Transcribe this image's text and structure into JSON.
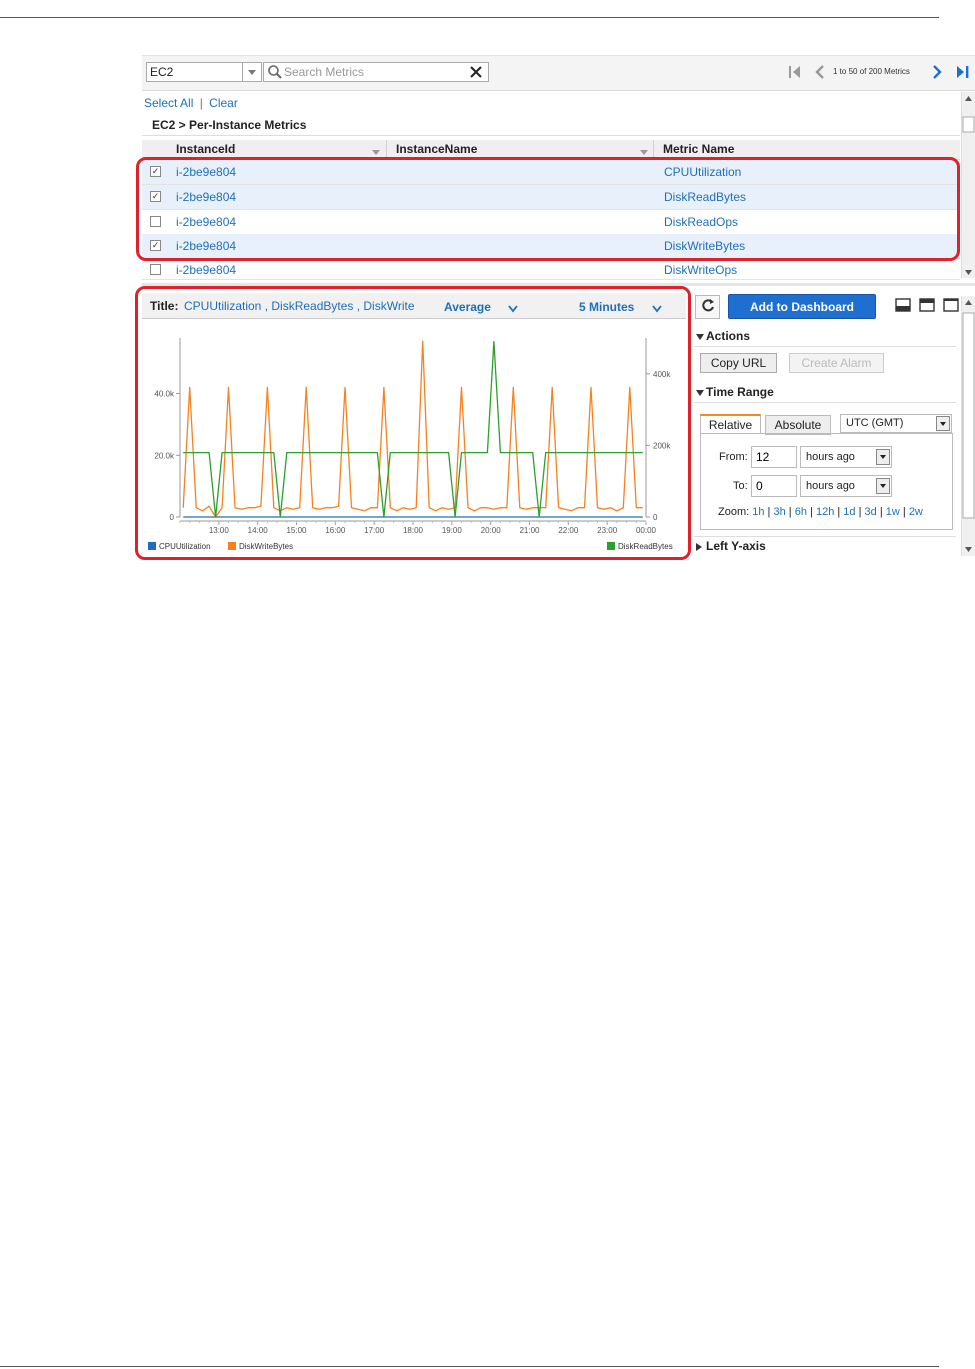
{
  "toolbar": {
    "namespace": "EC2",
    "search_placeholder": "Search Metrics",
    "pager_text": "1 to 50 of 200 Metrics"
  },
  "selection": {
    "select_all": "Select All",
    "separator": "|",
    "clear": "Clear"
  },
  "group_title": "EC2 > Per-Instance Metrics",
  "table": {
    "columns": [
      "InstanceId",
      "InstanceName",
      "Metric Name"
    ],
    "rows": [
      {
        "checked": true,
        "instance_id": "i-2be9e804",
        "instance_name": "",
        "metric": "CPUUtilization"
      },
      {
        "checked": true,
        "instance_id": "i-2be9e804",
        "instance_name": "",
        "metric": "DiskReadBytes"
      },
      {
        "checked": false,
        "instance_id": "i-2be9e804",
        "instance_name": "",
        "metric": "DiskReadOps"
      },
      {
        "checked": true,
        "instance_id": "i-2be9e804",
        "instance_name": "",
        "metric": "DiskWriteBytes"
      },
      {
        "checked": false,
        "instance_id": "i-2be9e804",
        "instance_name": "",
        "metric": "DiskWriteOps"
      }
    ]
  },
  "graph": {
    "title_label": "Title:",
    "title_value": "CPUUtilization , DiskReadBytes , DiskWrite",
    "statistic": "Average",
    "period": "5 Minutes"
  },
  "right_panel": {
    "add_to_dashboard": "Add to Dashboard",
    "actions_label": "Actions",
    "copy_url": "Copy URL",
    "create_alarm": "Create Alarm",
    "time_range_label": "Time Range",
    "tab_relative": "Relative",
    "tab_absolute": "Absolute",
    "timezone": "UTC (GMT)",
    "from_label": "From:",
    "from_value": "12",
    "from_unit": "hours ago",
    "to_label": "To:",
    "to_value": "0",
    "to_unit": "hours ago",
    "zoom_label": "Zoom:",
    "zoom_options": [
      "1h",
      "3h",
      "6h",
      "12h",
      "1d",
      "3d",
      "1w",
      "2w"
    ],
    "left_y_axis": "Left Y-axis"
  },
  "colors": {
    "cpu": "#1f6fb8",
    "diskwrite": "#f58220",
    "diskread": "#2ca02c",
    "highlight": "#e0202b"
  },
  "chart_data": {
    "type": "line",
    "x": [
      "12:05",
      "12:15",
      "12:25",
      "12:35",
      "12:45",
      "12:55",
      "13:05",
      "13:15",
      "13:25",
      "13:35",
      "13:45",
      "13:55",
      "14:05",
      "14:15",
      "14:25",
      "14:35",
      "14:45",
      "14:55",
      "15:05",
      "15:15",
      "15:25",
      "15:35",
      "15:45",
      "15:55",
      "16:05",
      "16:15",
      "16:25",
      "16:35",
      "16:45",
      "16:55",
      "17:05",
      "17:15",
      "17:25",
      "17:35",
      "17:45",
      "17:55",
      "18:05",
      "18:15",
      "18:25",
      "18:35",
      "18:45",
      "18:55",
      "19:05",
      "19:15",
      "19:25",
      "19:35",
      "19:45",
      "19:55",
      "20:05",
      "20:15",
      "20:25",
      "20:35",
      "20:45",
      "20:55",
      "21:05",
      "21:15",
      "21:25",
      "21:35",
      "21:45",
      "21:55",
      "22:05",
      "22:15",
      "22:25",
      "22:35",
      "22:45",
      "22:55",
      "23:05",
      "23:15",
      "23:25",
      "23:35",
      "23:45",
      "23:55"
    ],
    "x_ticks": [
      "13:00",
      "14:00",
      "15:00",
      "16:00",
      "17:00",
      "18:00",
      "19:00",
      "20:00",
      "21:00",
      "22:00",
      "23:00",
      "00:00"
    ],
    "series": [
      {
        "name": "CPUUtilization",
        "axis": "left",
        "color": "#1f6fb8",
        "values": [
          0,
          0,
          0,
          0,
          0,
          0,
          0,
          0,
          0,
          0,
          0,
          0,
          0,
          0,
          0,
          0,
          0,
          0,
          0,
          0,
          0,
          0,
          0,
          0,
          0,
          0,
          0,
          0,
          0,
          0,
          0,
          0,
          0,
          0,
          0,
          0,
          0,
          0,
          0,
          0,
          0,
          0,
          0,
          0,
          0,
          0,
          0,
          0,
          0,
          0,
          0,
          0,
          0,
          0,
          0,
          0,
          0,
          0,
          0,
          0,
          0,
          0,
          0,
          0,
          0,
          0,
          0,
          0,
          0,
          0,
          0,
          0
        ]
      },
      {
        "name": "DiskWriteBytes",
        "axis": "left",
        "color": "#f58220",
        "values": [
          3000,
          42000,
          3000,
          2000,
          3500,
          0,
          3000,
          42000,
          3000,
          2500,
          3000,
          3000,
          3500,
          42000,
          3000,
          2000,
          3000,
          2500,
          3000,
          42000,
          3000,
          2500,
          3000,
          3000,
          3500,
          42000,
          3000,
          2500,
          2000,
          3000,
          3000,
          42000,
          3000,
          2000,
          3000,
          2500,
          3000,
          57000,
          3000,
          2000,
          3000,
          2500,
          3000,
          42000,
          3000,
          2000,
          3000,
          3000,
          2500,
          3000,
          3000,
          42000,
          3000,
          2500,
          3000,
          3000,
          3000,
          42000,
          3000,
          2500,
          2000,
          3000,
          3000,
          42000,
          3000,
          2500,
          3000,
          2000,
          3000,
          42000,
          3000,
          3000
        ]
      },
      {
        "name": "DiskReadBytes",
        "axis": "right",
        "color": "#2ca02c",
        "values": [
          180000,
          180000,
          180000,
          180000,
          180000,
          0,
          180000,
          180000,
          180000,
          180000,
          180000,
          180000,
          180000,
          180000,
          180000,
          0,
          180000,
          180000,
          180000,
          180000,
          180000,
          180000,
          180000,
          180000,
          180000,
          180000,
          180000,
          180000,
          180000,
          180000,
          180000,
          0,
          180000,
          180000,
          180000,
          180000,
          180000,
          180000,
          180000,
          180000,
          180000,
          180000,
          0,
          180000,
          180000,
          180000,
          180000,
          180000,
          490000,
          180000,
          180000,
          180000,
          180000,
          180000,
          180000,
          0,
          180000,
          180000,
          180000,
          180000,
          180000,
          180000,
          180000,
          180000,
          180000,
          180000,
          180000,
          180000,
          180000,
          180000,
          180000,
          180000
        ]
      }
    ],
    "left_axis": {
      "ylim": [
        0,
        58000
      ],
      "ticks": [
        "0",
        "20.0k",
        "40.0k"
      ],
      "tick_values": [
        0,
        20000,
        40000
      ]
    },
    "right_axis": {
      "ylim": [
        0,
        500000
      ],
      "ticks": [
        "0",
        "200k",
        "400k"
      ],
      "tick_values": [
        0,
        200000,
        400000
      ]
    },
    "legend": [
      "CPUUtilization",
      "DiskWriteBytes",
      "DiskReadBytes"
    ]
  }
}
